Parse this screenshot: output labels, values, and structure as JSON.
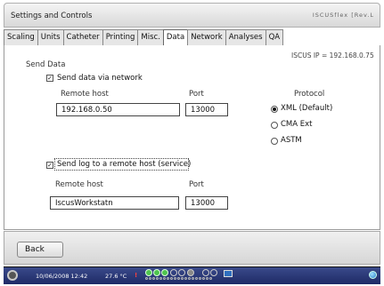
{
  "window": {
    "title": "Settings and Controls",
    "brand": "ISCUSflex [Rev.L"
  },
  "tabs": [
    {
      "label": "Scaling",
      "active": false
    },
    {
      "label": "Units",
      "active": false
    },
    {
      "label": "Catheter",
      "active": false
    },
    {
      "label": "Printing",
      "active": false
    },
    {
      "label": "Misc.",
      "active": false
    },
    {
      "label": "Data",
      "active": true
    },
    {
      "label": "Network",
      "active": false
    },
    {
      "label": "Analyses",
      "active": false
    },
    {
      "label": "QA",
      "active": false
    }
  ],
  "panel": {
    "section_title": "Send Data",
    "ip_info": "ISCUS IP = 192.168.0.75",
    "send_network": {
      "label": "Send data via network",
      "checked": true,
      "remote_host_label": "Remote host",
      "remote_host_value": "192.168.0.50",
      "port_label": "Port",
      "port_value": "13000"
    },
    "protocol": {
      "label": "Protocol",
      "options": [
        {
          "label": "XML (Default)",
          "selected": true
        },
        {
          "label": "CMA Ext",
          "selected": false
        },
        {
          "label": "ASTM",
          "selected": false
        }
      ]
    },
    "send_log": {
      "label": "Send log to a remote host (service)",
      "checked": true,
      "remote_host_label": "Remote host",
      "remote_host_value": "IscusWorkstatn",
      "port_label": "Port",
      "port_value": "13000"
    }
  },
  "footer": {
    "back_label": "Back"
  },
  "status": {
    "datetime": "10/06/2008 12:42",
    "temperature": "27.6 °C",
    "alarm": "!"
  },
  "colors": {
    "status_bar": "#26337a",
    "indicator_green": "#4ec44e"
  }
}
